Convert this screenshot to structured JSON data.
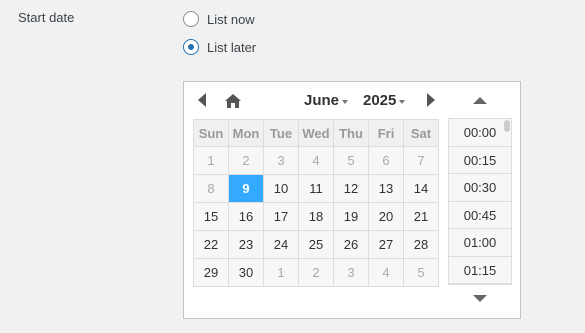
{
  "field": {
    "label": "Start date"
  },
  "options": {
    "list_now": "List now",
    "list_later": "List later",
    "selected": "list_later"
  },
  "picker": {
    "month": "June",
    "year": "2025",
    "weekdays": [
      "Sun",
      "Mon",
      "Tue",
      "Wed",
      "Thu",
      "Fri",
      "Sat"
    ],
    "weeks": [
      [
        "1",
        "2",
        "3",
        "4",
        "5",
        "6",
        "7"
      ],
      [
        "8",
        "9",
        "10",
        "11",
        "12",
        "13",
        "14"
      ],
      [
        "15",
        "16",
        "17",
        "18",
        "19",
        "20",
        "21"
      ],
      [
        "22",
        "23",
        "24",
        "25",
        "26",
        "27",
        "28"
      ],
      [
        "29",
        "30",
        "1",
        "2",
        "3",
        "4",
        "5"
      ]
    ],
    "selected_day": "9",
    "times": [
      "00:00",
      "00:15",
      "00:30",
      "00:45",
      "01:00",
      "01:15"
    ]
  }
}
